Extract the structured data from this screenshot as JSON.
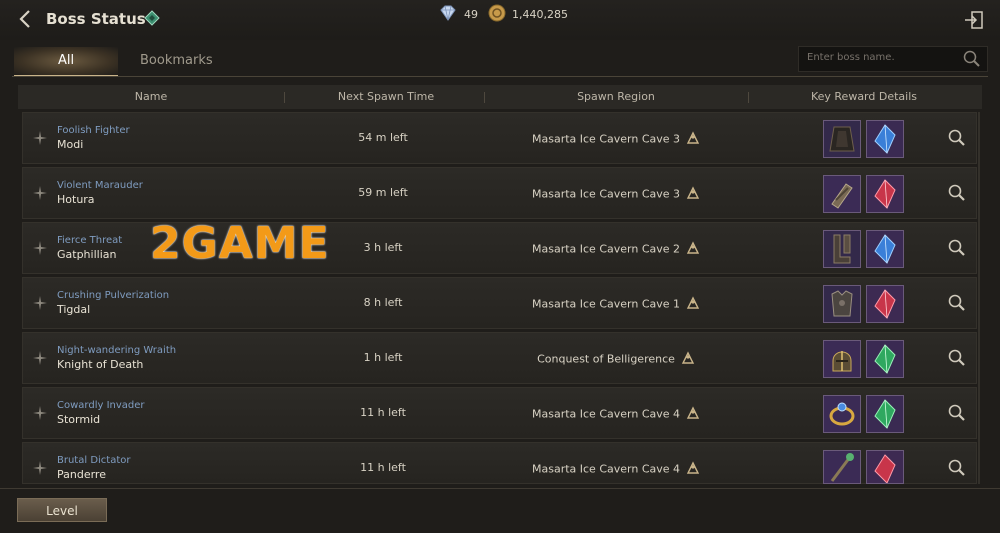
{
  "header": {
    "title": "Boss Status",
    "diamonds": "49",
    "gold": "1,440,285"
  },
  "tabs": [
    {
      "label": "All",
      "active": true
    },
    {
      "label": "Bookmarks",
      "active": false
    }
  ],
  "search": {
    "placeholder": "Enter boss name."
  },
  "columns": {
    "name": "Name",
    "spawn": "Next Spawn Time",
    "region": "Spawn Region",
    "reward": "Key Reward Details"
  },
  "bosses": [
    {
      "epithet": "Foolish Fighter",
      "name": "Modi",
      "spawn": "54 m left",
      "region": "Masarta Ice Cavern Cave 3",
      "reward1": "dark-cloak",
      "reward2": "blue-crystal"
    },
    {
      "epithet": "Violent Marauder",
      "name": "Hotura",
      "spawn": "59 m left",
      "region": "Masarta Ice Cavern Cave 3",
      "reward1": "gauntlet",
      "reward2": "red-crystal"
    },
    {
      "epithet": "Fierce Threat",
      "name": "Gatphillian",
      "spawn": "3 h left",
      "region": "Masarta Ice Cavern Cave 2",
      "reward1": "boots",
      "reward2": "blue-crystal"
    },
    {
      "epithet": "Crushing Pulverization",
      "name": "Tigdal",
      "spawn": "8 h left",
      "region": "Masarta Ice Cavern Cave 1",
      "reward1": "armor",
      "reward2": "red-crystal"
    },
    {
      "epithet": "Night-wandering Wraith",
      "name": "Knight of Death",
      "spawn": "1 h left",
      "region": "Conquest of Belligerence",
      "reward1": "helmet",
      "reward2": "green-crystal"
    },
    {
      "epithet": "Cowardly Invader",
      "name": "Stormid",
      "spawn": "11 h left",
      "region": "Masarta Ice Cavern Cave 4",
      "reward1": "ring",
      "reward2": "green-crystal"
    },
    {
      "epithet": "Brutal Dictator",
      "name": "Panderre",
      "spawn": "11 h left",
      "region": "Masarta Ice Cavern Cave 4",
      "reward1": "staff",
      "reward2": "red-crystal"
    }
  ],
  "footer": {
    "level_label": "Level"
  },
  "watermark": "2GAME",
  "colors": {
    "epithet": "#7f9cc0",
    "accent": "#c9b48a",
    "reward_bg": "#3b2b4e"
  }
}
